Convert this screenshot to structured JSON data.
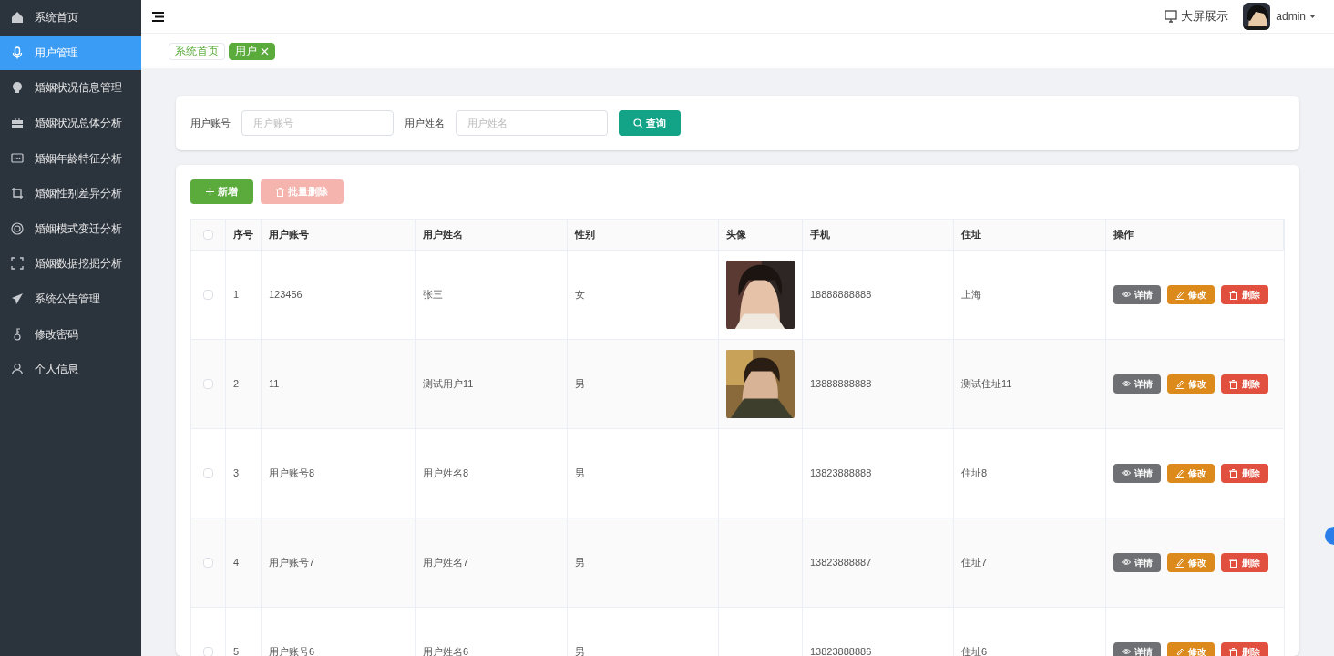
{
  "sidebar": {
    "items": [
      {
        "label": "系统首页",
        "selected": false
      },
      {
        "label": "用户管理",
        "selected": true
      },
      {
        "label": "婚姻状况信息管理",
        "selected": false
      },
      {
        "label": "婚姻状况总体分析",
        "selected": false
      },
      {
        "label": "婚姻年龄特征分析",
        "selected": false
      },
      {
        "label": "婚姻性别差异分析",
        "selected": false
      },
      {
        "label": "婚姻模式变迁分析",
        "selected": false
      },
      {
        "label": "婚姻数据挖掘分析",
        "selected": false
      },
      {
        "label": "系统公告管理",
        "selected": false
      },
      {
        "label": "修改密码",
        "selected": false
      },
      {
        "label": "个人信息",
        "selected": false
      }
    ]
  },
  "header": {
    "big_screen": "大屏展示",
    "user": "admin"
  },
  "tabs": [
    {
      "label": "系统首页",
      "selected": false
    },
    {
      "label": "用户",
      "selected": true
    }
  ],
  "search": {
    "fields": [
      {
        "label": "用户账号",
        "placeholder": "用户账号"
      },
      {
        "label": "用户姓名",
        "placeholder": "用户姓名"
      }
    ],
    "button": "查询"
  },
  "toolbar": {
    "add": "新增",
    "batch_delete": {
      "label": "批量删除",
      "disabled": true
    }
  },
  "table": {
    "columns": [
      "序号",
      "用户账号",
      "用户姓名",
      "性别",
      "头像",
      "手机",
      "住址",
      "操作"
    ],
    "all_checked": false,
    "rows": [
      {
        "cells": [
          "1",
          "123456",
          "张三",
          "女"
        ],
        "avatar": {
          "kind": "picture"
        },
        "phone": "18888888888",
        "address": "上海",
        "checked": false,
        "actions": [
          "详情",
          "修改",
          "删除"
        ]
      },
      {
        "cells": [
          "2",
          "11",
          "测试用户11",
          "男"
        ],
        "avatar": {
          "kind": "picture"
        },
        "phone": "13888888888",
        "address": "测试住址11",
        "checked": false,
        "actions": [
          "详情",
          "修改",
          "删除"
        ]
      },
      {
        "cells": [
          "3",
          "用户账号8",
          "用户姓名8",
          "男"
        ],
        "phone": "13823888888",
        "address": "住址8",
        "checked": false,
        "actions": [
          "详情",
          "修改",
          "删除"
        ]
      },
      {
        "cells": [
          "4",
          "用户账号7",
          "用户姓名7",
          "男"
        ],
        "phone": "13823888887",
        "address": "住址7",
        "checked": false,
        "actions": [
          "详情",
          "修改",
          "删除"
        ]
      },
      {
        "cells": [
          "5",
          "用户账号6",
          "用户姓名6",
          "男"
        ],
        "phone": "13823888886",
        "address": "住址6",
        "checked": false,
        "actions": [
          "详情",
          "修改",
          "删除"
        ]
      }
    ]
  }
}
